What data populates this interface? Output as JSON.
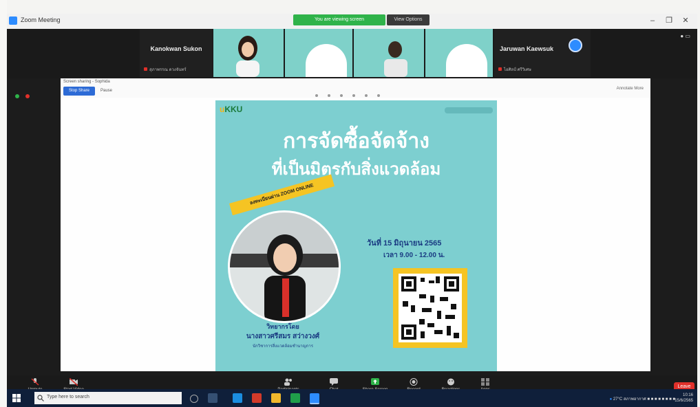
{
  "window": {
    "title": "Zoom Meeting",
    "banner_green": "You are viewing screen",
    "banner_dark": "View Options",
    "controls": [
      "–",
      "❐",
      "✕"
    ]
  },
  "participants": [
    {
      "name": "Kanokwan Sukon",
      "sub": "สุภาพรรณ ดวงจันทร์",
      "type": "name"
    },
    {
      "type": "video"
    },
    {
      "type": "video"
    },
    {
      "type": "video"
    },
    {
      "type": "video"
    },
    {
      "name": "Jaruwan Kaewsuk",
      "sub": "ไอศิลป์ ศรีวิเศษ",
      "type": "name"
    }
  ],
  "share": {
    "title": "Screen sharing - Sophida",
    "stop_button": "Stop Share",
    "pause_link": "Pause",
    "right_label": "Annotate  More"
  },
  "poster": {
    "logo": "KKU",
    "headline_line1": "การจัดซื้อจัดจ้าง",
    "headline_line2": "ที่เป็นมิตรกับสิ่งแวดล้อม",
    "ribbon": "ลงทะเบียนผ่าน ZOOM ONLINE",
    "date_line": "วันที่ 15 มิถุนายน 2565",
    "time_line": "เวลา 9.00 - 12.00 น.",
    "speaker_role": "วิทยากรโดย",
    "speaker_name": "นางสาวศรีสมร สว่างวงศ์",
    "speaker_title": "นักวิชาการสิ่งแวดล้อมชำนาญการ"
  },
  "toolbar": {
    "items": [
      "Unmute",
      "Start Video",
      "Participants",
      "Chat",
      "Share Screen",
      "Record",
      "Reactions",
      "Apps"
    ],
    "end_label": "Leave"
  },
  "taskbar": {
    "search_placeholder": "Type here to search",
    "tray_text": "27°C สภาพอากาศ",
    "time": "10:16",
    "date": "15/6/2565"
  }
}
